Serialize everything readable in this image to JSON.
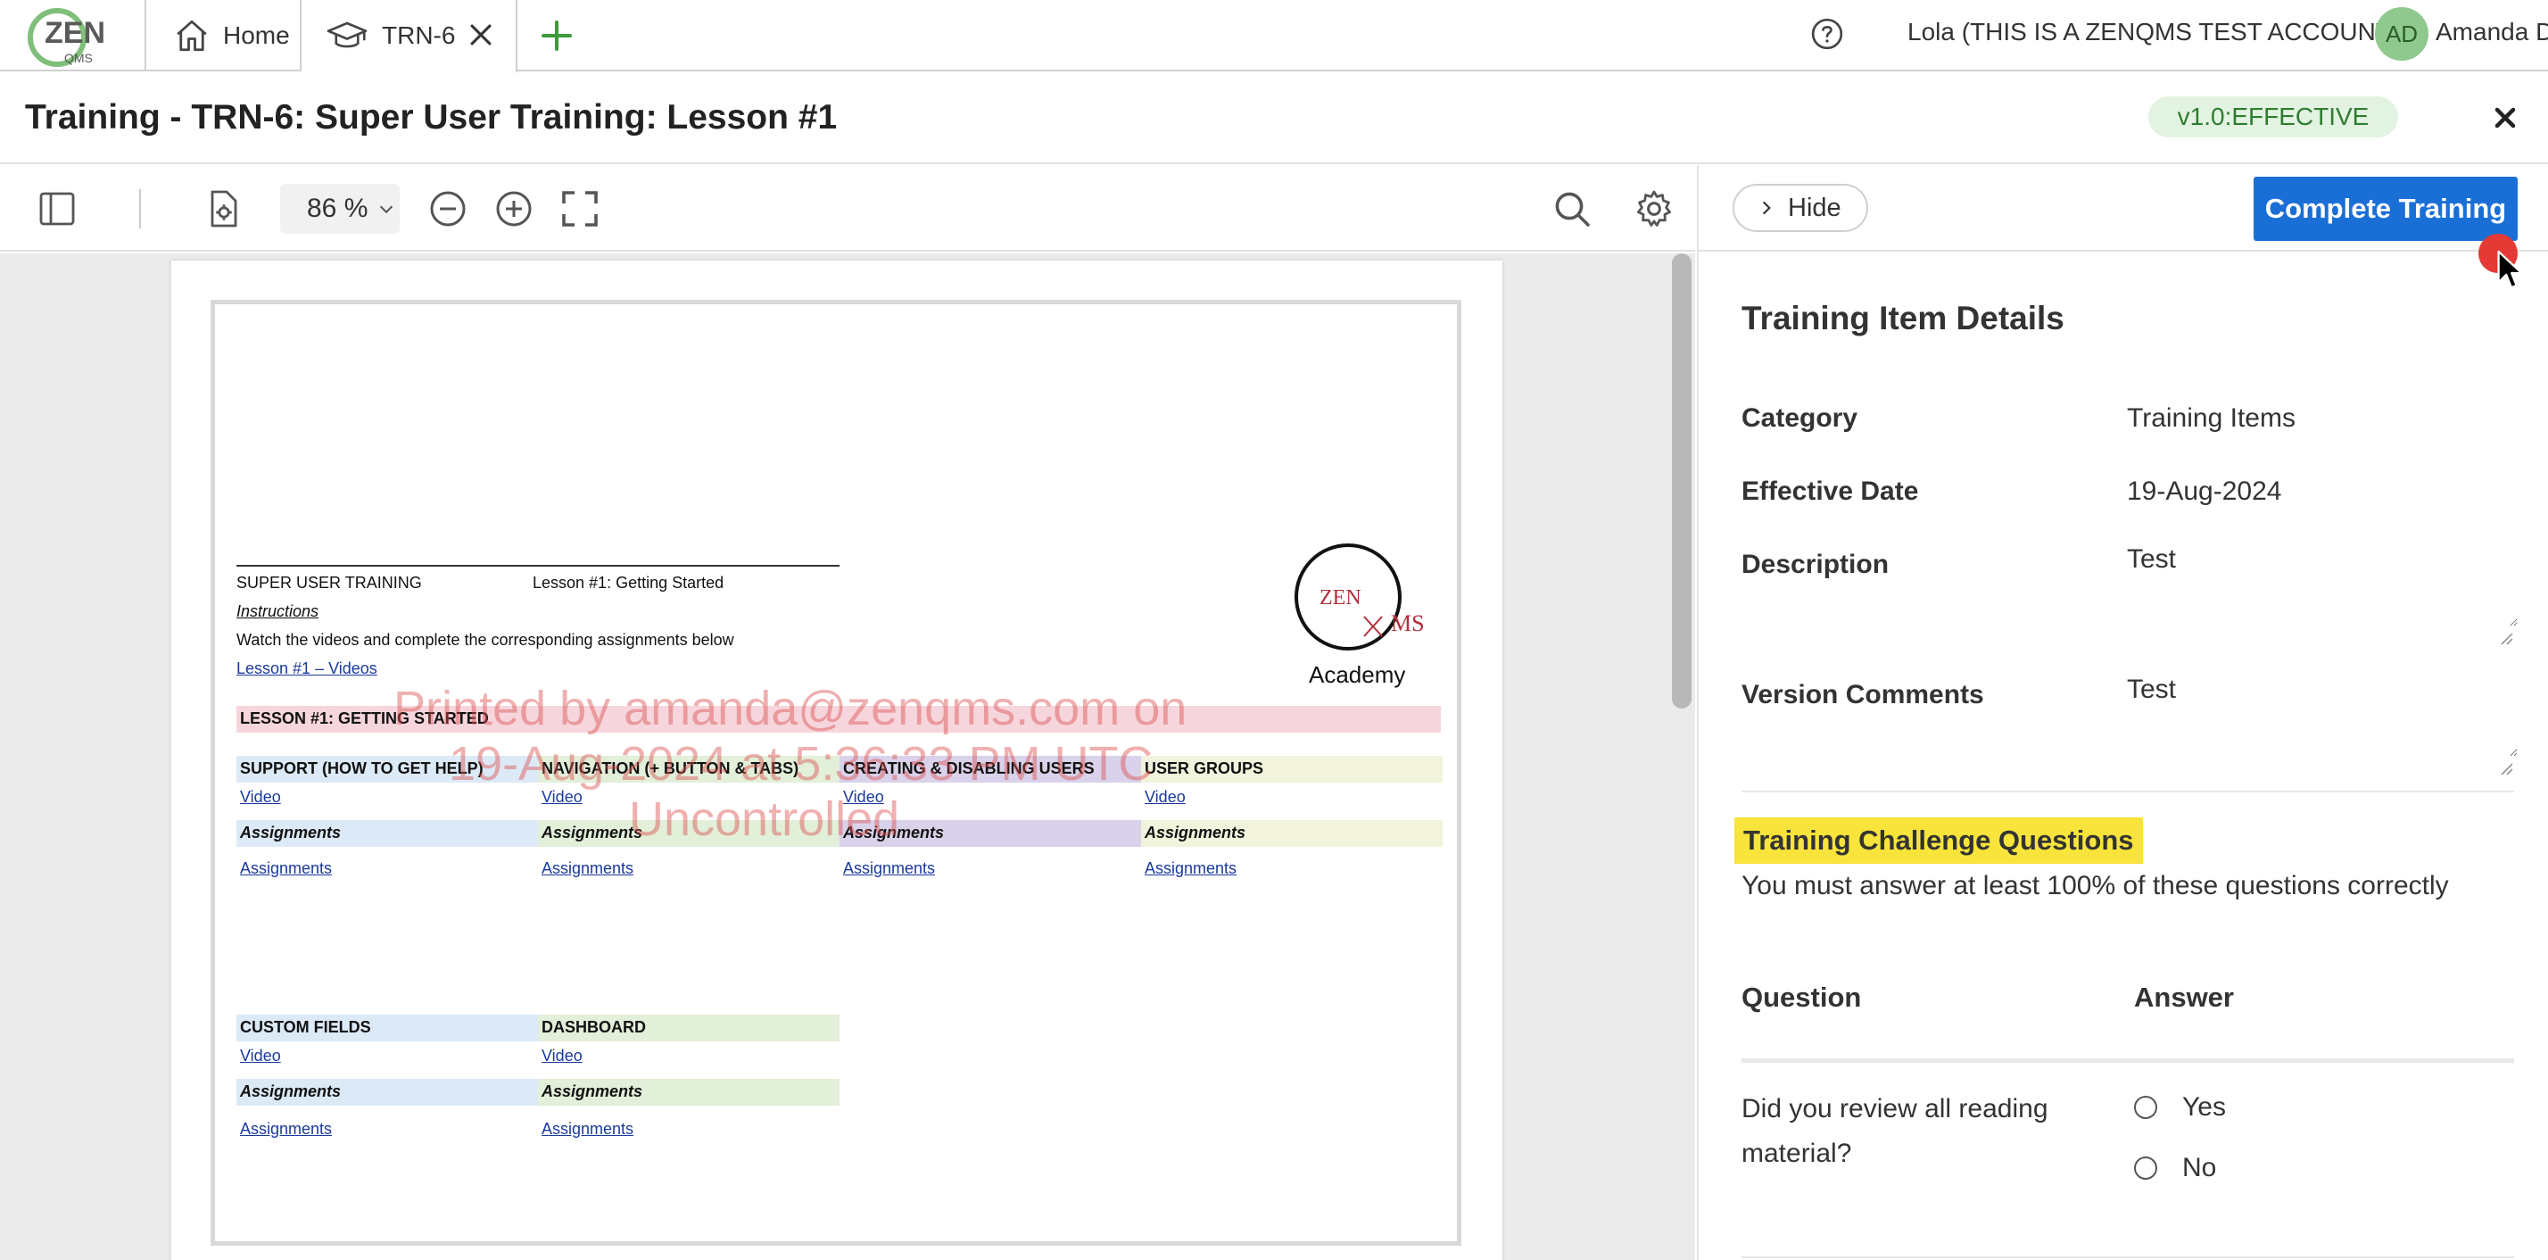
{
  "tabs": {
    "home_label": "Home",
    "training_label": "TRN-6"
  },
  "header": {
    "account_label": "Lola (THIS IS A ZENQMS TEST ACCOUNT)",
    "avatar_initials": "AD",
    "user_name": "Amanda D"
  },
  "titlebar": {
    "title": "Training - TRN-6: Super User Training: Lesson #1",
    "version_badge": "v1.0:EFFECTIVE"
  },
  "viewer": {
    "zoom_label": "86 %"
  },
  "document": {
    "header_left": "SUPER USER TRAINING",
    "header_right": "Lesson #1: Getting Started",
    "instructions_label": "Instructions",
    "instructions_text": "Watch the videos and complete the corresponding assignments below",
    "videos_link": "Lesson #1 – Videos",
    "lesson_band": "LESSON #1: GETTING STARTED",
    "academy_label": "Academy",
    "logo_text_left": "ZEN",
    "logo_text_right": "MS",
    "sections_row1": [
      {
        "title": "SUPPORT (HOW TO GET HELP)",
        "video": "Video",
        "assign_head": "Assignments",
        "assign_link": "Assignments"
      },
      {
        "title": "NAVIGATION (+ BUTTON & TABS)",
        "video": "Video",
        "assign_head": "Assignments",
        "assign_link": "Assignments"
      },
      {
        "title": "CREATING & DISABLING USERS",
        "video": "Video",
        "assign_head": "Assignments",
        "assign_link": "Assignments"
      },
      {
        "title": "USER GROUPS",
        "video": "Video",
        "assign_head": "Assignments",
        "assign_link": "Assignments"
      }
    ],
    "sections_row2": [
      {
        "title": "CUSTOM FIELDS",
        "video": "Video",
        "assign_head": "Assignments",
        "assign_link": "Assignments"
      },
      {
        "title": "DASHBOARD",
        "video": "Video",
        "assign_head": "Assignments",
        "assign_link": "Assignments"
      }
    ],
    "watermark_line1": "Printed by amanda@zenqms.com on",
    "watermark_line2": "19-Aug-2024 at 5:36:33 PM UTC",
    "watermark_line3": "Uncontrolled"
  },
  "panel": {
    "hide_label": "Hide",
    "complete_label": "Complete Training",
    "section_title": "Training Item Details",
    "category_label": "Category",
    "category_value": "Training Items",
    "effective_label": "Effective Date",
    "effective_value": "19-Aug-2024",
    "description_label": "Description",
    "description_value": "Test",
    "version_comments_label": "Version Comments",
    "version_comments_value": "Test",
    "challenge_title": "Training Challenge Questions",
    "challenge_sub": "You must answer at least 100% of these questions correctly",
    "question_col": "Question",
    "answer_col": "Answer",
    "question_1": "Did you review all reading material?",
    "answer_yes": "Yes",
    "answer_no": "No"
  },
  "colors": {
    "accent_blue": "#1a6fd6",
    "badge_green_bg": "#e3f3e1",
    "badge_green_text": "#2e7d32",
    "highlight_yellow": "#f8e43a",
    "band_pink": "#f6d6dc",
    "band_blue": "#dce9f6",
    "band_green": "#e2efd9",
    "band_purple": "#d9d2ea",
    "band_yellow": "#f2f3dc"
  },
  "icons": [
    "zenqms-logo",
    "home-icon",
    "graduation-cap-icon",
    "close-icon",
    "plus-icon",
    "help-icon",
    "sidebar-toggle-icon",
    "document-settings-icon",
    "chevron-down-icon",
    "zoom-out-icon",
    "zoom-in-icon",
    "fullscreen-icon",
    "search-icon",
    "gear-icon",
    "chevron-right-icon"
  ]
}
